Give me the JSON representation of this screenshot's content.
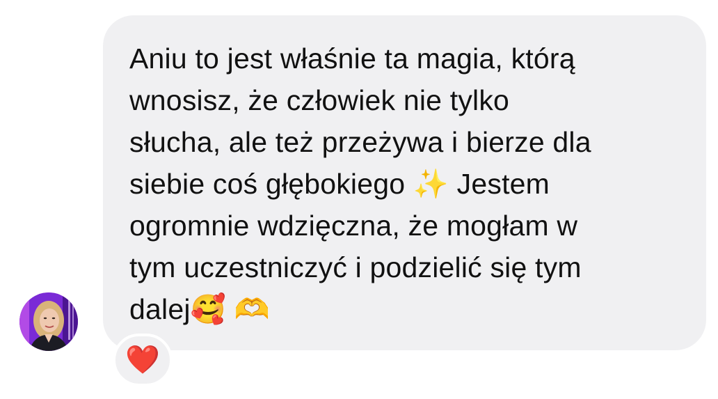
{
  "message": {
    "lines": [
      "Aniu to jest właśnie ta magia, którą",
      "wnosisz, że człowiek nie tylko",
      "słucha, ale też przeżywa i bierze dla",
      "siebie coś głębokiego ✨ Jestem",
      "ogromnie wdzięczna, że mogłam w",
      "tym uczestniczyć i podzielić się tym",
      "dalej🥰 🫶"
    ]
  },
  "reaction": {
    "emoji": "❤️"
  },
  "colors": {
    "bubble": "#f0f0f2",
    "text": "#111111",
    "avatar_ring": "#8b2fe0"
  }
}
